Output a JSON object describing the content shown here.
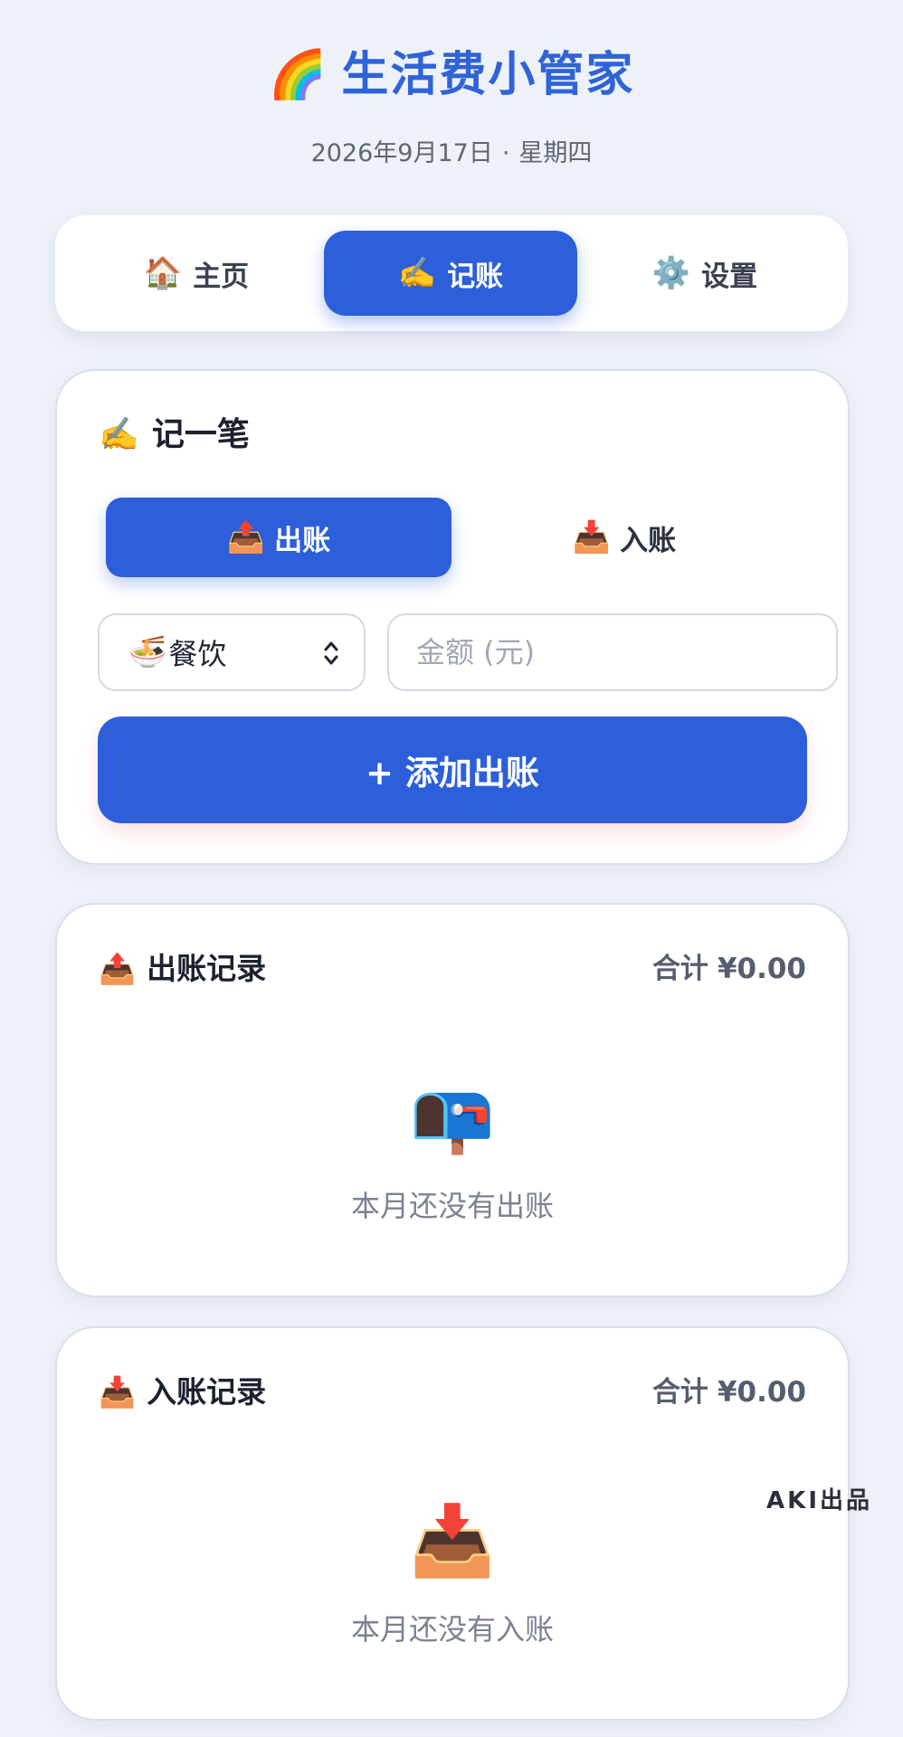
{
  "header": {
    "title_emoji": "🌈",
    "title": "生活费小管家",
    "date": "2026年9月17日",
    "separator": "·",
    "weekday": "星期四"
  },
  "nav": {
    "tabs": [
      {
        "emoji": "🏠",
        "label": "主页",
        "active": false
      },
      {
        "emoji": "✍️",
        "label": "记账",
        "active": true
      },
      {
        "emoji": "⚙️",
        "label": "设置",
        "active": false
      }
    ]
  },
  "entry": {
    "heading_emoji": "✍️",
    "heading": "记一笔",
    "type_out": {
      "emoji": "📤",
      "label": "出账",
      "selected": true
    },
    "type_in": {
      "emoji": "📥",
      "label": "入账",
      "selected": false
    },
    "category": {
      "emoji": "🍜",
      "label": "餐饮"
    },
    "amount": {
      "value": "",
      "placeholder": "金额 (元)"
    },
    "add_button": "+ 添加出账"
  },
  "outgoing": {
    "emoji": "📤",
    "title": "出账记录",
    "total_label": "合计",
    "total_value": "¥0.00",
    "empty_emoji": "📭",
    "empty_text": "本月还没有出账"
  },
  "incoming": {
    "emoji": "📥",
    "title": "入账记录",
    "total_label": "合计",
    "total_value": "¥0.00",
    "empty_emoji": "📥",
    "empty_text": "本月还没有入账"
  },
  "watermark": "AKI出品",
  "colors": {
    "primary": "#2c5fd9",
    "title": "#2f63d8",
    "background": "#eef2f8"
  }
}
